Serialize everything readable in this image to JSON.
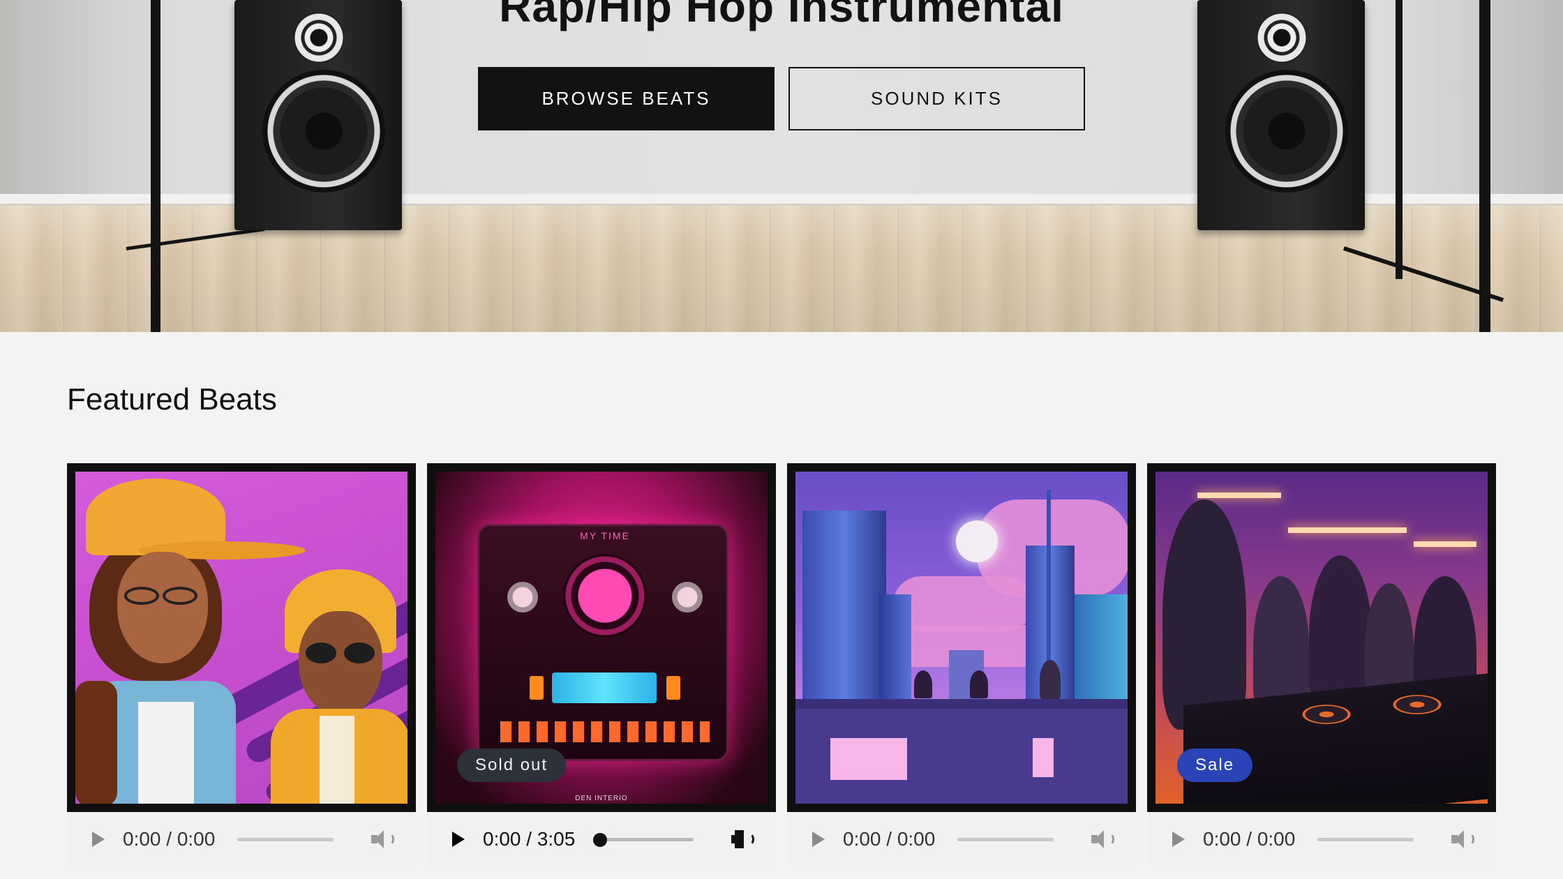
{
  "hero": {
    "title": "Rap/Hip Hop Instrumental",
    "primary_button": "BROWSE BEATS",
    "secondary_button": "SOUND KITS"
  },
  "featured": {
    "heading": "Featured Beats",
    "cards": [
      {
        "badge": "",
        "time": "0:00 / 0:00",
        "state": "idle"
      },
      {
        "badge": "Sold out",
        "time": "0:00 / 3:05",
        "state": "ready",
        "art_text": "MY TIME",
        "art_footer": "DEN INTERIO"
      },
      {
        "badge": "",
        "time": "0:00 / 0:00",
        "state": "idle"
      },
      {
        "badge": "Sale",
        "time": "0:00 / 0:00",
        "state": "idle"
      }
    ]
  },
  "colors": {
    "primary_button_bg": "#121212",
    "sold_out_badge": "#2d3139",
    "sale_badge": "#2a44b8",
    "page_bg": "#f3f3f3"
  },
  "icons": [
    "play-icon",
    "volume-icon"
  ]
}
